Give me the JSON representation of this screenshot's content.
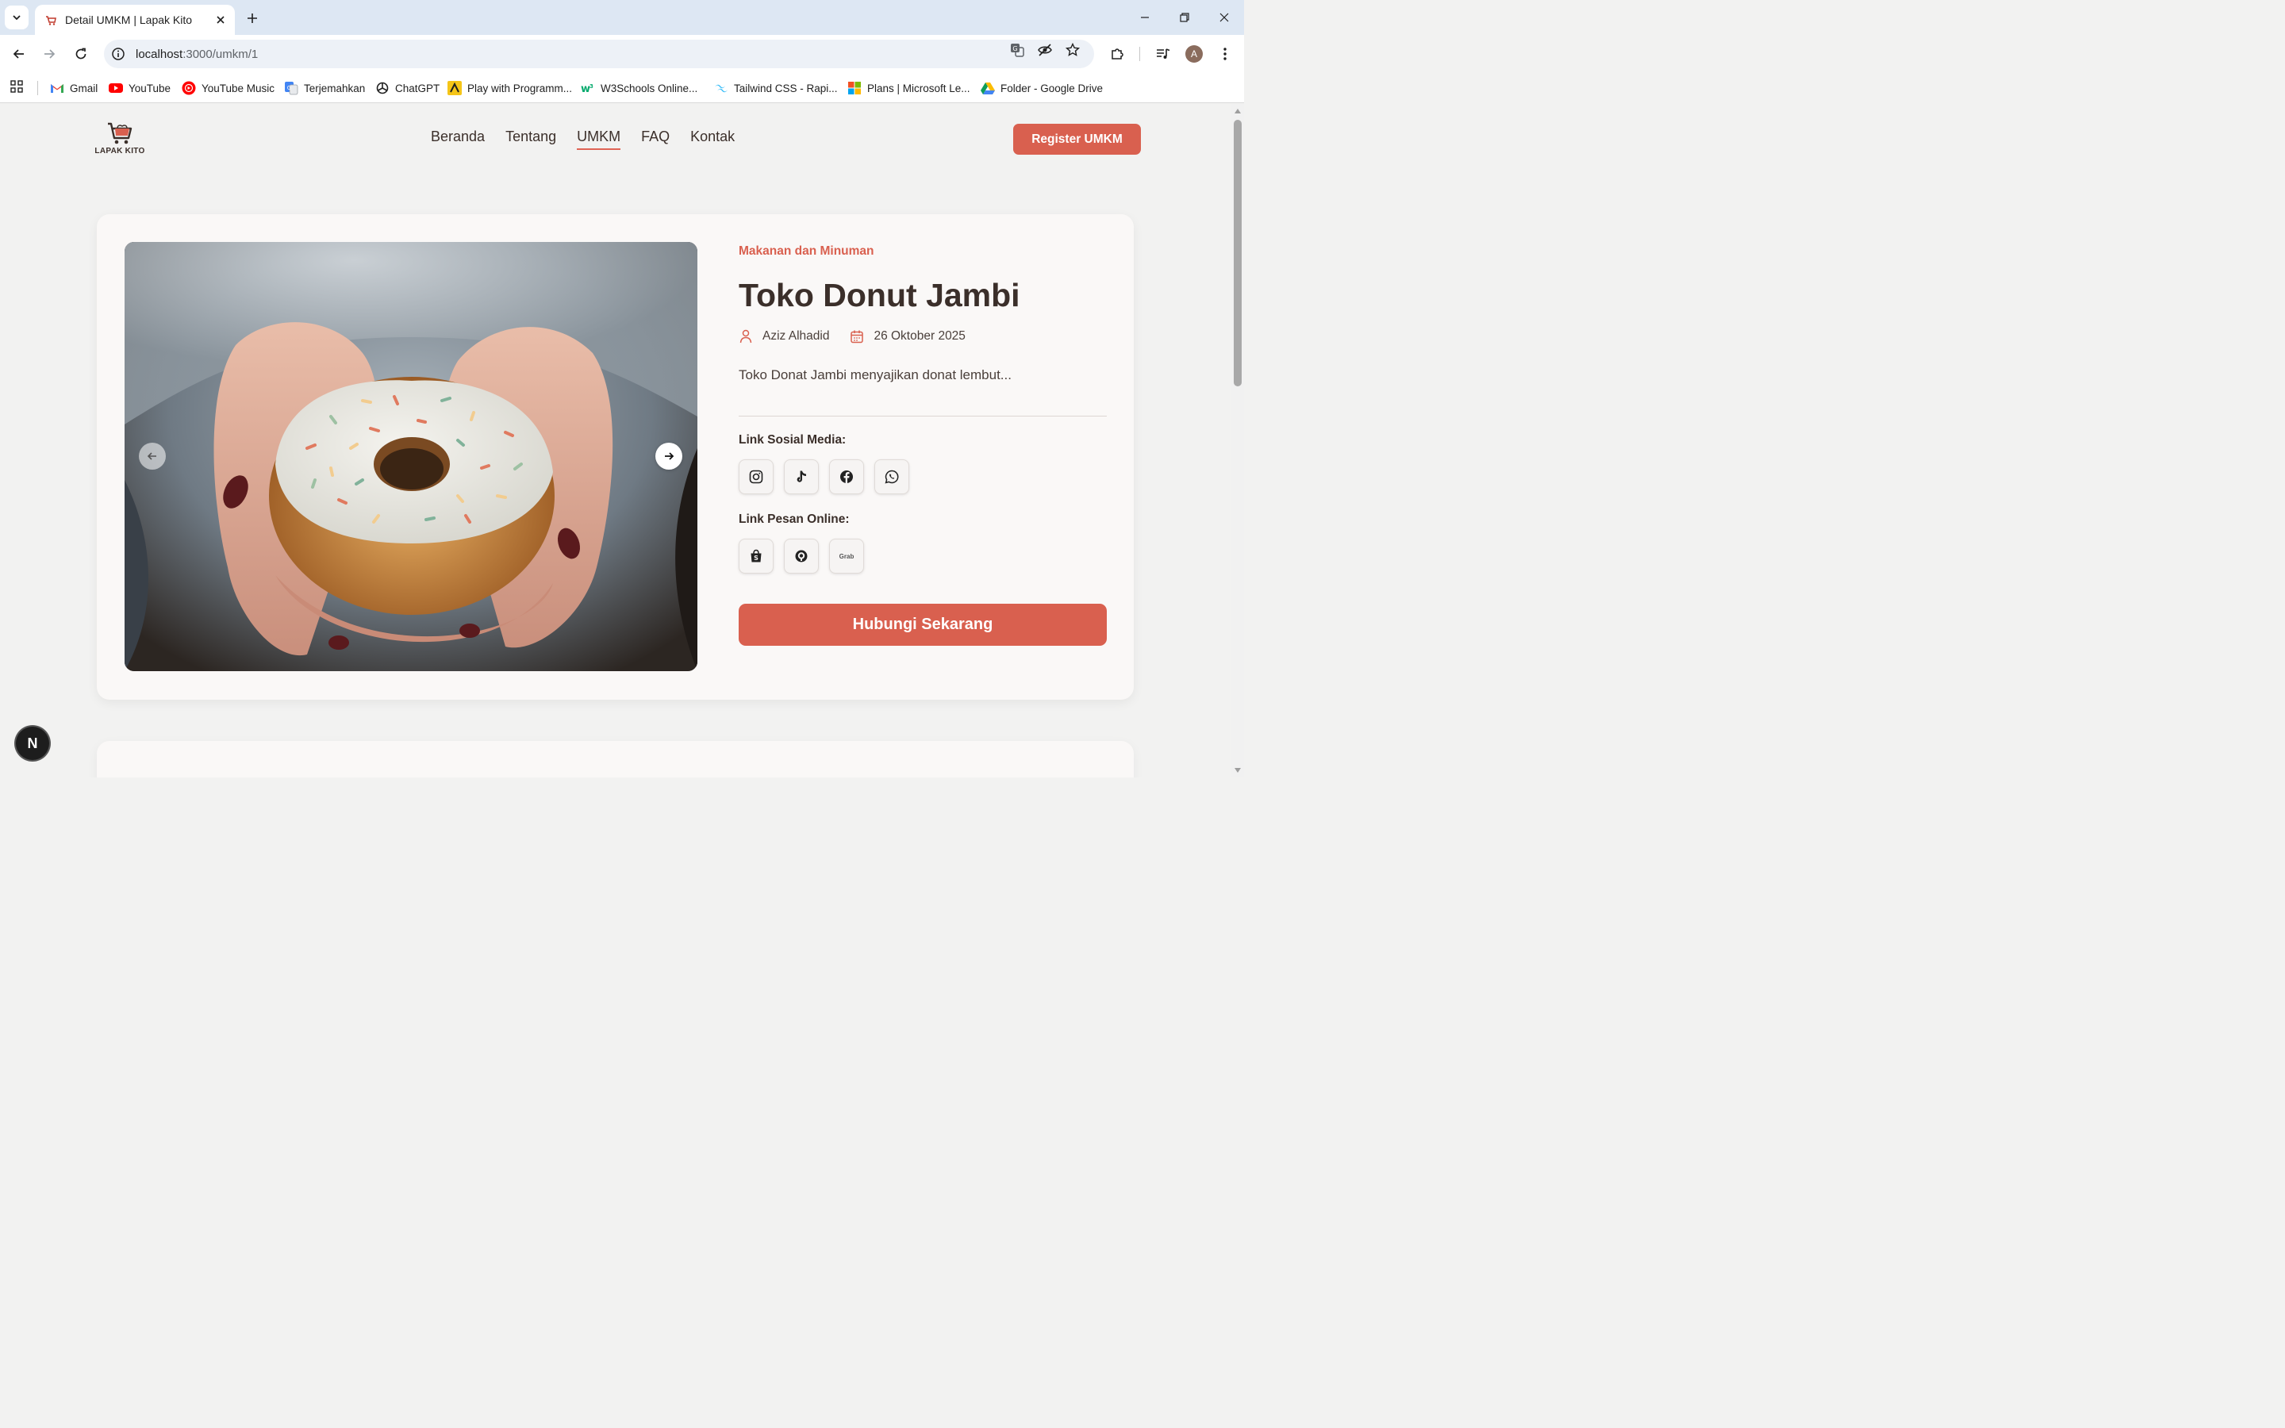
{
  "browser": {
    "tab_title": "Detail UMKM | Lapak Kito",
    "url_host": "localhost",
    "url_path": ":3000/umkm/1",
    "profile_initial": "A",
    "bookmarks": [
      {
        "label": "Gmail",
        "icon": "gmail-icon"
      },
      {
        "label": "YouTube",
        "icon": "youtube-icon"
      },
      {
        "label": "YouTube Music",
        "icon": "youtube-music-icon"
      },
      {
        "label": "Terjemahkan",
        "icon": "google-translate-icon"
      },
      {
        "label": "ChatGPT",
        "icon": "chatgpt-icon"
      },
      {
        "label": "Play with Programm...",
        "icon": "programming-icon"
      },
      {
        "label": "W3Schools Online...",
        "icon": "w3schools-icon"
      },
      {
        "label": "Tailwind CSS - Rapi...",
        "icon": "tailwind-icon"
      },
      {
        "label": "Plans | Microsoft Le...",
        "icon": "microsoft-icon"
      },
      {
        "label": "Folder - Google Drive",
        "icon": "google-drive-icon"
      }
    ]
  },
  "site": {
    "logo_text": "LAPAK KITO",
    "nav": [
      {
        "label": "Beranda",
        "active": false
      },
      {
        "label": "Tentang",
        "active": false
      },
      {
        "label": "UMKM",
        "active": true
      },
      {
        "label": "FAQ",
        "active": false
      },
      {
        "label": "Kontak",
        "active": false
      }
    ],
    "register_label": "Register UMKM"
  },
  "detail": {
    "category": "Makanan dan Minuman",
    "name": "Toko Donut Jambi",
    "owner": "Aziz Alhadid",
    "date": "26 Oktober 2025",
    "description": "Toko Donat Jambi menyajikan donat lembut...",
    "social_label": "Link Sosial Media:",
    "social_icons": [
      "instagram-icon",
      "tiktok-icon",
      "facebook-icon",
      "whatsapp-icon"
    ],
    "order_label": "Link Pesan Online:",
    "order_icons": [
      "shopee-icon",
      "gojek-icon",
      "grab-icon"
    ],
    "grab_text": "Grab",
    "contact_label": "Hubungi Sekarang"
  },
  "colors": {
    "accent": "#d9604f",
    "text": "#3b2f2a",
    "page_bg": "#f2f2f1",
    "card_bg": "#faf8f7"
  },
  "dev_badge": "N"
}
